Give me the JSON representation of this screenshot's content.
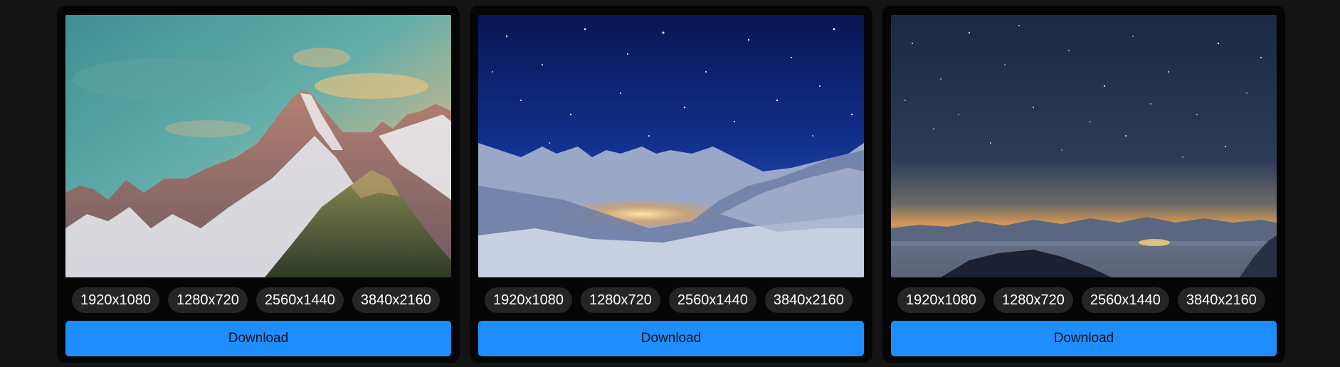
{
  "cards": [
    {
      "image": "snowy-mountain-sunset-photo",
      "resolutions": [
        "1920x1080",
        "1280x720",
        "2560x1440",
        "3840x2160"
      ],
      "download_label": "Download"
    },
    {
      "image": "starry-night-snow-mountains-photo",
      "resolutions": [
        "1920x1080",
        "1280x720",
        "2560x1440",
        "3840x2160"
      ],
      "download_label": "Download"
    },
    {
      "image": "milky-way-over-valley-photo",
      "resolutions": [
        "1920x1080",
        "1280x720",
        "2560x1440",
        "3840x2160"
      ],
      "download_label": "Download"
    }
  ],
  "colors": {
    "page_bg": "#141414",
    "card_bg": "#050505",
    "chip_bg": "#252525",
    "button_bg": "#1e8eff"
  }
}
